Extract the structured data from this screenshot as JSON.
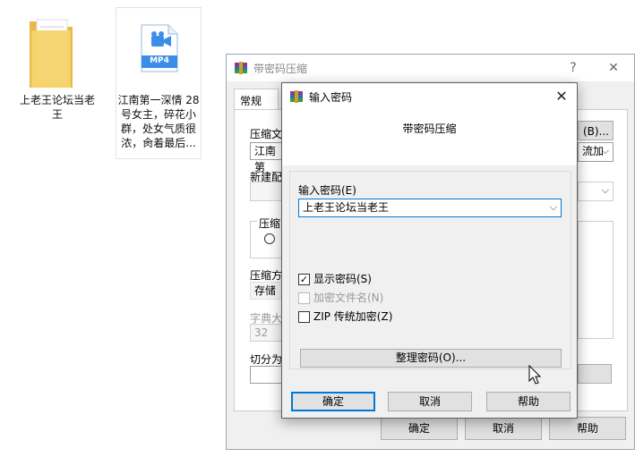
{
  "desktop": {
    "items": [
      {
        "label": "上老王论坛当老\n王",
        "icon": "folder-icon"
      },
      {
        "label": "江南第一深情 28\n号女主，碎花小\n群，处女气质很\n浓，肏着最后...",
        "icon": "mp4-file-icon",
        "badge": "MP4"
      }
    ]
  },
  "back_window": {
    "title": "带密码压缩",
    "help_glyph": "?",
    "close_glyph": "✕",
    "tab_general": "常规",
    "label_archive": "压缩文",
    "archive_value": "江南第",
    "browse_button": "(B)...",
    "right_combo_value": "流加",
    "label_new_config": "新建配",
    "label_compress_type": "压缩",
    "label_method": "压缩方",
    "method_value": "存储",
    "label_dict": "字典大",
    "dict_value": "32",
    "label_split": "切分为",
    "ok_button": "确定",
    "cancel_button": "取消",
    "help_button": "帮助"
  },
  "dialog": {
    "title": "输入密码",
    "header": "带密码压缩",
    "password_label": "输入密码(E)",
    "password_value": "上老王论坛当老王",
    "show_password": {
      "label": "显示密码(S)",
      "checked": true
    },
    "encrypt_filenames": {
      "label": "加密文件名(N)",
      "checked": false,
      "disabled": true
    },
    "zip_legacy": {
      "label": "ZIP 传统加密(Z)",
      "checked": false
    },
    "organize_button": "整理密码(O)...",
    "ok_button": "确定",
    "cancel_button": "取消",
    "help_button": "帮助"
  },
  "colors": {
    "accent": "#0078d7",
    "folder": "#f6d36b",
    "mp4_icon": "#3b8ee8"
  }
}
